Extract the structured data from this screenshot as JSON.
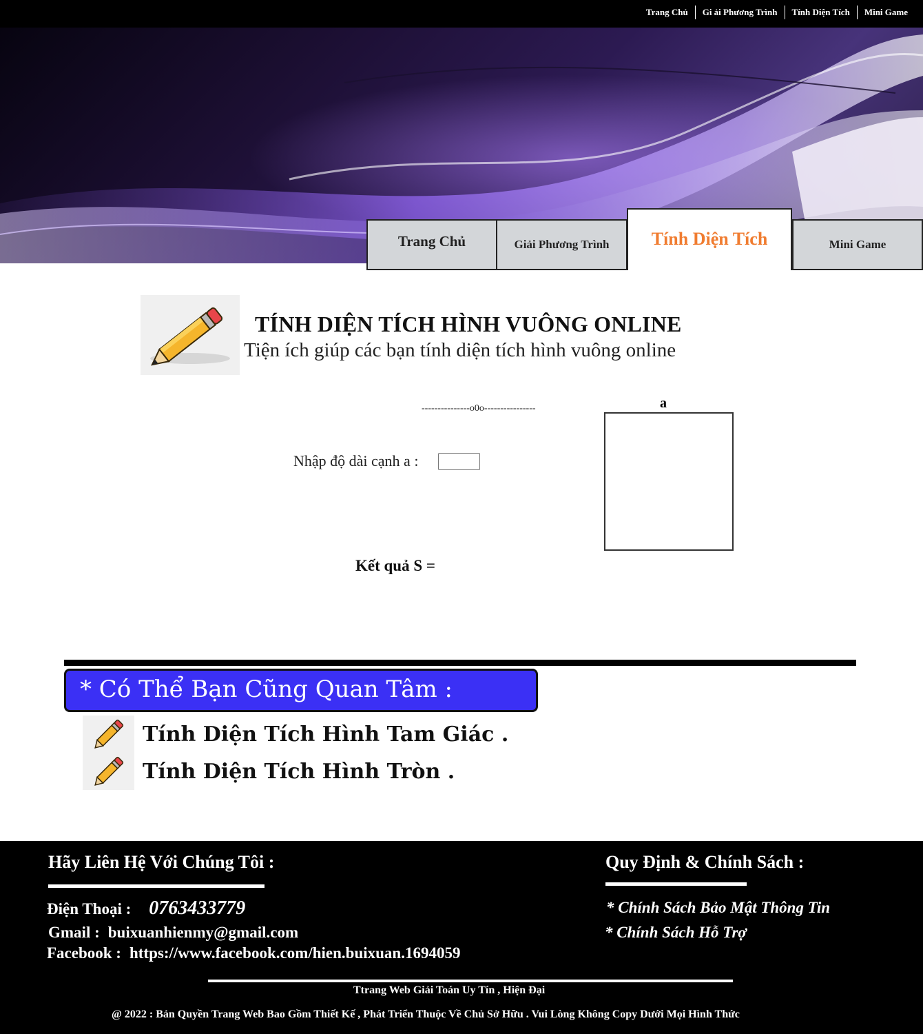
{
  "top_nav": {
    "items": [
      "Trang Chủ",
      "Gi ải Phương Trình",
      "Tính Diện Tích",
      "Mini Game"
    ]
  },
  "main_tabs": {
    "items": [
      {
        "label": "Trang Chủ",
        "active": false
      },
      {
        "label": "Giải Phương Trình",
        "active": false
      },
      {
        "label": "Tính Diện Tích",
        "active": true
      },
      {
        "label": "Mini Game",
        "active": false
      }
    ],
    "active_color": "#f07c30"
  },
  "header": {
    "title": "TÍNH DIỆN TÍCH HÌNH VUÔNG ONLINE",
    "subtitle": "Tiện ích giúp các bạn tính diện tích hình vuông online"
  },
  "calculator": {
    "divider": "---------------o0o----------------",
    "input_label": "Nhập độ dài cạnh a :",
    "input_value": "",
    "square_label": "a",
    "result_label": "Kết quả S =",
    "result_value": ""
  },
  "related": {
    "heading": "* Có Thể Bạn Cũng Quan Tâm :",
    "heading_color": "#3b30f5",
    "items": [
      "Tính Diện Tích Hình Tam Giác .",
      "Tính Diện Tích Hình Tròn ."
    ]
  },
  "footer": {
    "contact_heading": "Hãy Liên Hệ Với Chúng Tôi :",
    "phone_label": "Điện Thoại :",
    "phone_value": "0763433779",
    "gmail_label": "Gmail :",
    "gmail_value": "buixuanhienmy@gmail.com",
    "facebook_label": "Facebook :",
    "facebook_value": "https://www.facebook.com/hien.buixuan.1694059",
    "policy_heading": "Quy Định & Chính Sách :",
    "policies": [
      "* Chính Sách Bảo Mật Thông Tin",
      "* Chính Sách Hỗ Trợ"
    ],
    "tagline": "Ttrang Web Giải Toán Uy Tín , Hiện Đại",
    "copyright": "@ 2022 : Bản Quyền Trang Web Bao Gồm Thiết Kế , Phát Triển Thuộc Về Chủ Sở Hữu . Vui Lòng Không Copy Dưới Mọi Hình Thức"
  }
}
